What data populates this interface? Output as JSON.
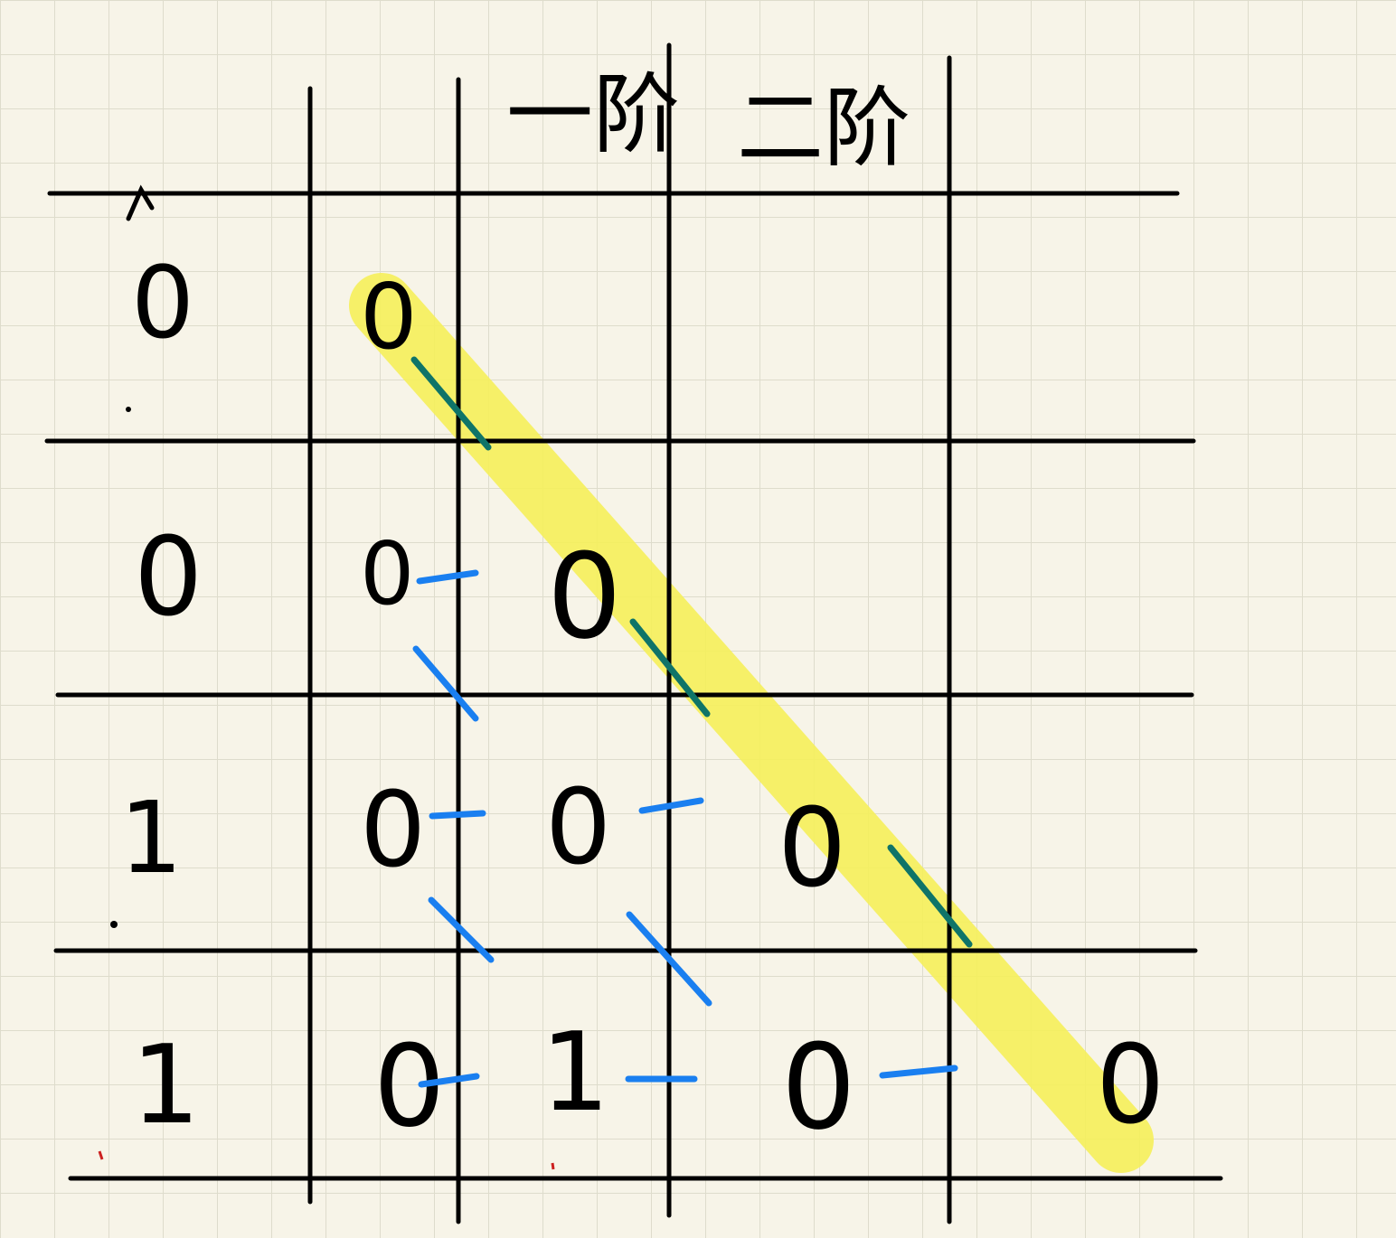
{
  "header": {
    "col_first": "一阶",
    "col_second": "二阶"
  },
  "row_labels": [
    "0",
    "0",
    "1",
    "1"
  ],
  "cells": [
    [
      "0"
    ],
    [
      "0",
      "0"
    ],
    [
      "0",
      "0",
      "0"
    ],
    [
      "0",
      "1",
      "0",
      "0"
    ]
  ],
  "colors": {
    "ink": "#000000",
    "highlight": "#f5f05a",
    "diagonal_stroke": "#0f7468",
    "difference_stroke": "#1a7ff0",
    "paper": "#f7f4e8",
    "grid": "#dedccc"
  }
}
